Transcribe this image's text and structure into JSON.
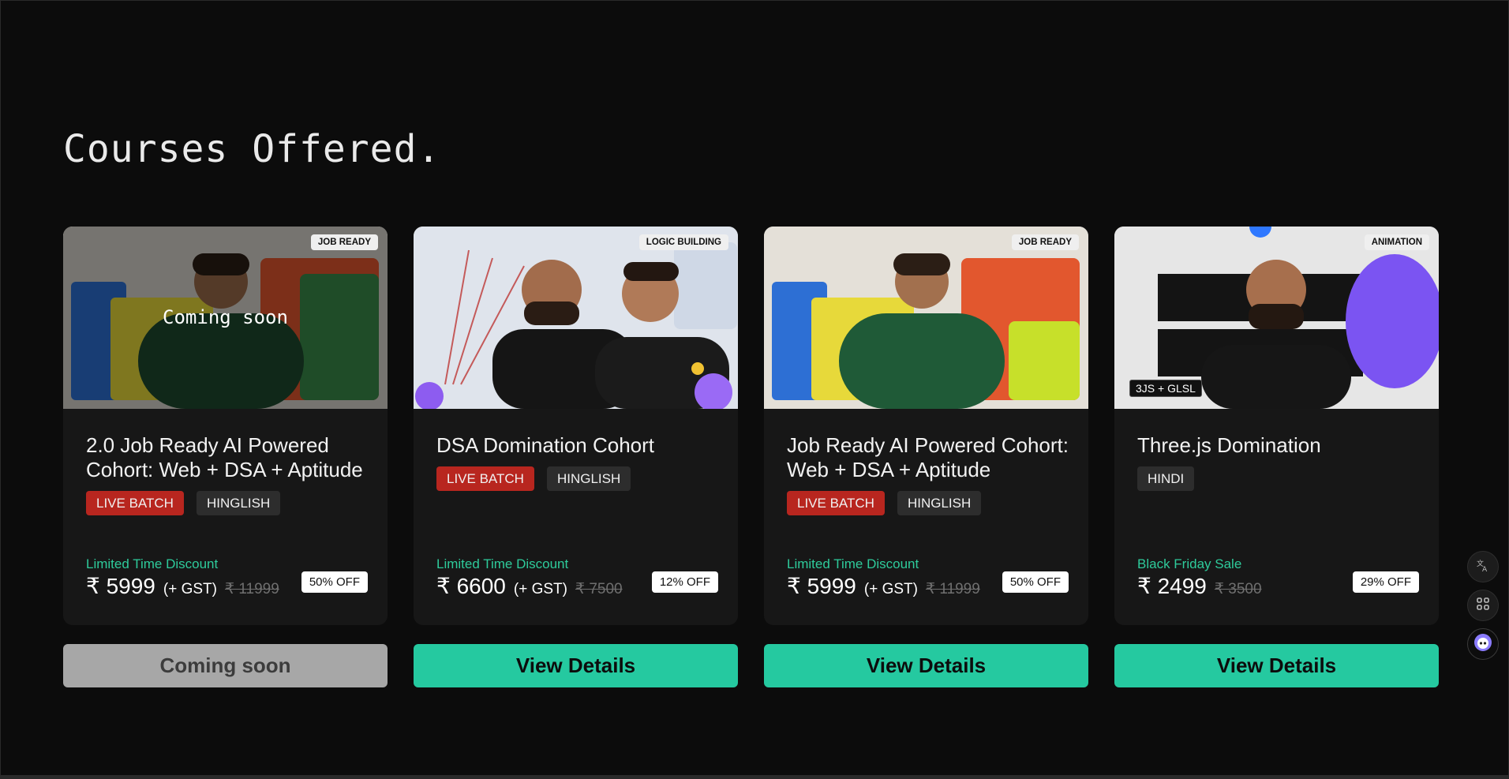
{
  "section": {
    "title": "Courses Offered."
  },
  "courses": [
    {
      "title": "2.0 Job Ready AI Powered Cohort: Web + DSA + Aptitude",
      "category": "JOB READY",
      "overlay": "Coming soon",
      "tags": {
        "live": "LIVE BATCH",
        "language": "HINGLISH"
      },
      "discount_label": "Limited Time Discount",
      "price": "₹ 5999",
      "gst": "(+ GST)",
      "old_price": "₹ 11999",
      "off": "50% OFF",
      "cta": "Coming soon"
    },
    {
      "title": "DSA Domination Cohort",
      "category": "LOGIC BUILDING",
      "tags": {
        "live": "LIVE BATCH",
        "language": "HINGLISH"
      },
      "discount_label": "Limited Time Discount",
      "price": "₹ 6600",
      "gst": "(+ GST)",
      "old_price": "₹ 7500",
      "off": "12% OFF",
      "cta": "View Details"
    },
    {
      "title": "Job Ready AI Powered Cohort: Web + DSA + Aptitude",
      "category": "JOB READY",
      "tags": {
        "live": "LIVE BATCH",
        "language": "HINGLISH"
      },
      "discount_label": "Limited Time Discount",
      "price": "₹ 5999",
      "gst": "(+ GST)",
      "old_price": "₹ 11999",
      "off": "50% OFF",
      "cta": "View Details"
    },
    {
      "title": "Three.js Domination",
      "category": "ANIMATION",
      "tech_badge": "3JS + GLSL",
      "tags": {
        "language": "HINDI"
      },
      "discount_label": "Black Friday Sale",
      "price": "₹ 2499",
      "old_price": "₹ 3500",
      "off": "29% OFF",
      "cta": "View Details"
    }
  ],
  "side_tools": [
    {
      "icon": "translate-icon"
    },
    {
      "icon": "apps-grid-icon"
    },
    {
      "icon": "assistant-bot-icon"
    }
  ],
  "colors": {
    "accent": "#25c9a0",
    "discount_text": "#2ecb9b",
    "live_badge": "#b8261f",
    "background": "#0c0c0c",
    "card": "#171717"
  }
}
